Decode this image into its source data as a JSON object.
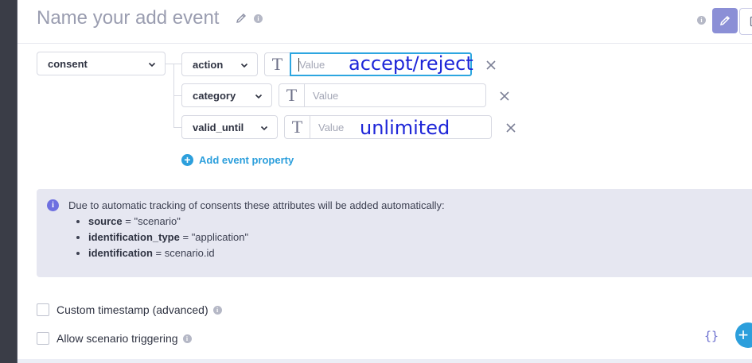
{
  "header": {
    "title": "Name your add event",
    "edit_icon": "pencil-icon",
    "code_icon": "terminal-icon"
  },
  "event": {
    "name": "consent",
    "properties": [
      {
        "key": "action",
        "value_placeholder": "Value",
        "annotation": "accept/reject",
        "focused": true
      },
      {
        "key": "category",
        "value_placeholder": "Value",
        "annotation": ""
      },
      {
        "key": "valid_until",
        "value_placeholder": "Value",
        "annotation": "unlimited"
      }
    ],
    "type_icon_text": "T",
    "add_property_label": "Add event property"
  },
  "notice": {
    "text": "Due to automatic tracking of consents these attributes will be added automatically:",
    "items": [
      {
        "key": "source",
        "op": " = ",
        "value": "\"scenario\""
      },
      {
        "key": "identification_type",
        "op": " = ",
        "value": "\"application\""
      },
      {
        "key": "identification",
        "op": " = ",
        "value": "scenario.id"
      }
    ]
  },
  "options": {
    "custom_timestamp_label": "Custom timestamp (advanced)",
    "allow_triggering_label": "Allow scenario triggering"
  },
  "footer": {
    "json_button_label": "{}",
    "fab_label": "+"
  },
  "colors": {
    "accent": "#2c9fdc",
    "edit_button": "#8b8fd6",
    "notice_bg": "#e6e7f1",
    "annotation_ink": "#1e26d8"
  }
}
